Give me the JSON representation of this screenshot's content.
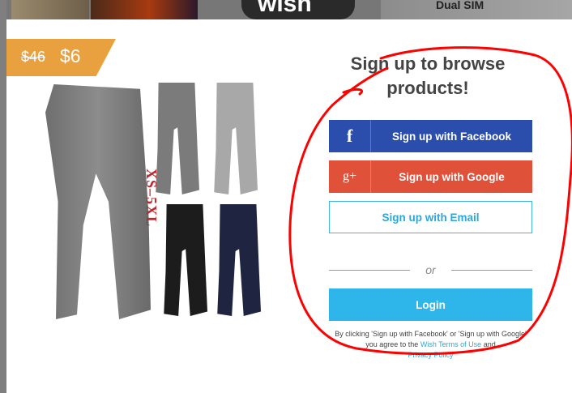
{
  "background": {
    "banner_text": "Dual SIM",
    "wish_logo_text": "wish"
  },
  "promo": {
    "old_price": "$46",
    "new_price": "$6"
  },
  "product": {
    "size_label": "XS–5XL"
  },
  "signup": {
    "heading_line1": "Sign up to browse",
    "heading_line2": "products!",
    "facebook_icon": "f",
    "facebook_label": "Sign up with Facebook",
    "google_icon": "g+",
    "google_label": "Sign up with Google",
    "email_label": "Sign up with Email",
    "divider_text": "or",
    "login_label": "Login",
    "terms_prefix": "By clicking 'Sign up with Facebook' or 'Sign up with Google' you agree to the",
    "terms_link": "Wish Terms of Use",
    "terms_and": "and",
    "privacy_link": "Privacy Policy"
  },
  "colors": {
    "facebook": "#2b4ead",
    "google": "#e0513a",
    "login": "#2eb5ea",
    "price_tag": "#e9a13f",
    "annotation": "#ff0000"
  }
}
